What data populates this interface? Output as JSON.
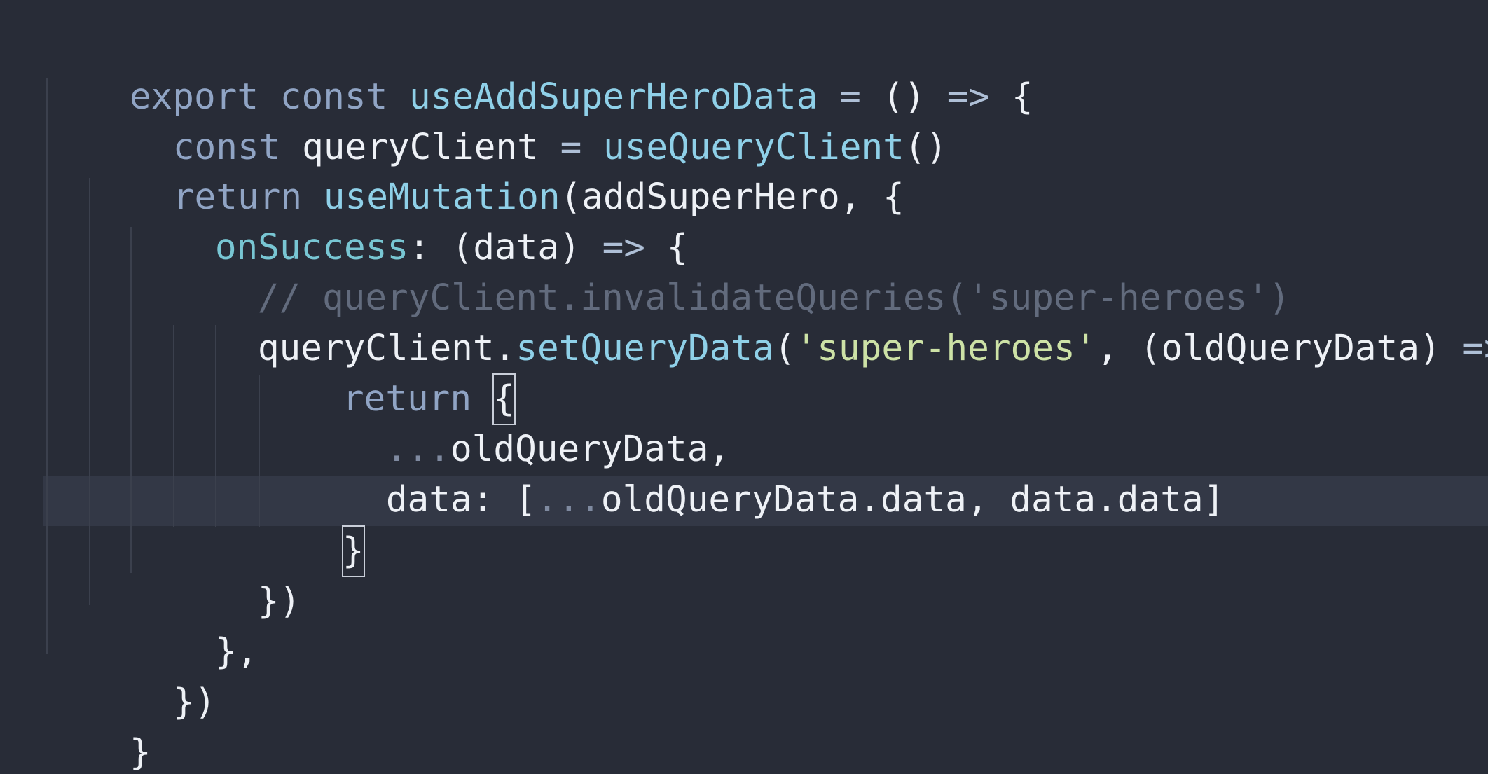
{
  "colors": {
    "background": "#282c37",
    "current_line": "#333846",
    "keyword": "#90a4c4",
    "function": "#8fd0e8",
    "property": "#78c6d3",
    "identifier": "#eef1f6",
    "string": "#cde2a6",
    "comment": "#626b7d"
  },
  "code": {
    "l1": {
      "t1": "export",
      "t2": "const",
      "t3": "useAddSuperHeroData",
      "t4": "=",
      "t5": "()",
      "t6": "=>",
      "t7": "{"
    },
    "l2": {
      "t1": "const",
      "t2": "queryClient",
      "t3": "=",
      "t4": "useQueryClient",
      "t5": "()"
    },
    "l3": {
      "t1": "return",
      "t2": "useMutation",
      "t3": "(",
      "t4": "addSuperHero",
      "t5": ", {"
    },
    "l4": {
      "t1": "onSuccess",
      "t2": ":",
      "t3": "(data)",
      "t4": "=>",
      "t5": "{"
    },
    "l5": {
      "t1": "// queryClient.invalidateQueries('super-heroes')"
    },
    "l6": {
      "t1": "queryClient",
      "t2": ".",
      "t3": "setQueryData",
      "t4": "(",
      "t5": "'super-heroes'",
      "t6": ", (oldQueryData)",
      "t7": "=>",
      "t8": "{"
    },
    "l7": {
      "t1": "return",
      "t2": "{"
    },
    "l8": {
      "t1": "...",
      "t2": "oldQueryData,"
    },
    "l9": {
      "t1": "data: [",
      "t2": "...",
      "t3": "oldQueryData.data, data.data]"
    },
    "l10": {
      "t1": "}"
    },
    "l11": {
      "t1": "})"
    },
    "l12": {
      "t1": "},"
    },
    "l13": {
      "t1": "})"
    },
    "l14": {
      "t1": "}"
    }
  }
}
